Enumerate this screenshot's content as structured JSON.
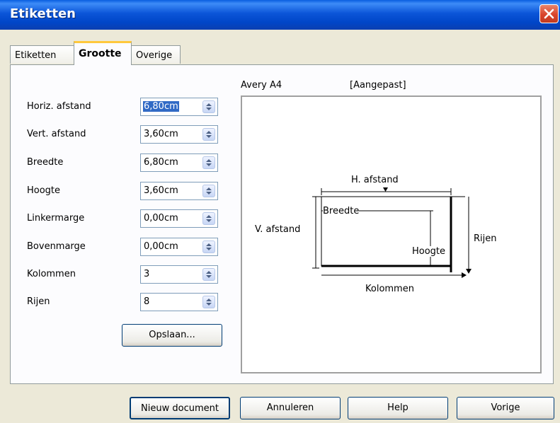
{
  "window": {
    "title": "Etiketten"
  },
  "tabs": [
    {
      "label": "Etiketten"
    },
    {
      "label": "Grootte"
    },
    {
      "label": "Overige"
    }
  ],
  "fields": [
    {
      "label": "Horiz. afstand",
      "value": "6,80cm",
      "selected": true
    },
    {
      "label": "Vert. afstand",
      "value": "3,60cm"
    },
    {
      "label": "Breedte",
      "value": "6,80cm"
    },
    {
      "label": "Hoogte",
      "value": "3,60cm"
    },
    {
      "label": "Linkermarge",
      "value": "0,00cm"
    },
    {
      "label": "Bovenmarge",
      "value": "0,00cm"
    },
    {
      "label": "Kolommen",
      "value": "3"
    },
    {
      "label": "Rijen",
      "value": "8"
    }
  ],
  "save_button": "Opslaan...",
  "preview": {
    "brand": "Avery A4",
    "type": "[Aangepast]",
    "h_afstand": "H. afstand",
    "v_afstand": "V. afstand",
    "breedte": "Breedte",
    "hoogte": "Hoogte",
    "rijen": "Rijen",
    "kolommen": "Kolommen"
  },
  "footer": {
    "new_document": "Nieuw document",
    "cancel": "Annuleren",
    "help": "Help",
    "back": "Vorige"
  },
  "colors": {
    "title_bar": "#0b55d8",
    "selection": "#316ac5",
    "tab_accent": "#ffc83c"
  }
}
